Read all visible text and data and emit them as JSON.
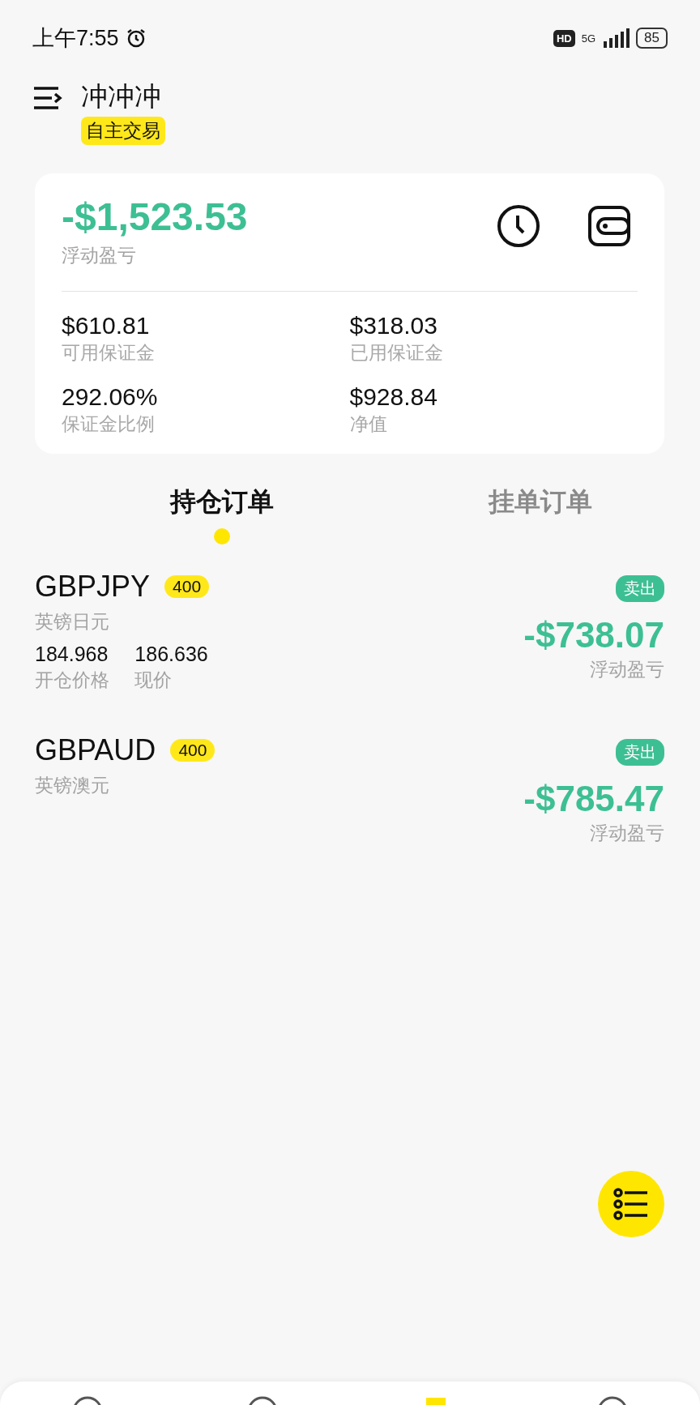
{
  "status_bar": {
    "time": "上午7:55",
    "hd": "HD",
    "network": "5G",
    "battery": "85"
  },
  "header": {
    "title": "冲冲冲",
    "mode_badge": "自主交易"
  },
  "account": {
    "floating_pnl": "-$1,523.53",
    "floating_pnl_label": "浮动盈亏",
    "stats": [
      {
        "value": "$610.81",
        "label": "可用保证金"
      },
      {
        "value": "$318.03",
        "label": "已用保证金"
      },
      {
        "value": "292.06%",
        "label": "保证金比例"
      },
      {
        "value": "$928.84",
        "label": "净值"
      }
    ]
  },
  "tabs": [
    {
      "label": "持仓订单",
      "selected": true
    },
    {
      "label": "挂单订单",
      "selected": false
    }
  ],
  "positions": [
    {
      "symbol": "GBPJPY",
      "lots": "400",
      "name": "英镑日元",
      "side": "卖出",
      "open_price": "184.968",
      "open_price_label": "开仓价格",
      "current_price": "186.636",
      "current_price_label": "现价",
      "pnl": "-$738.07",
      "pnl_label": "浮动盈亏"
    },
    {
      "symbol": "GBPAUD",
      "lots": "400",
      "name": "英镑澳元",
      "side": "卖出",
      "pnl": "-$785.47",
      "pnl_label": "浮动盈亏"
    }
  ]
}
